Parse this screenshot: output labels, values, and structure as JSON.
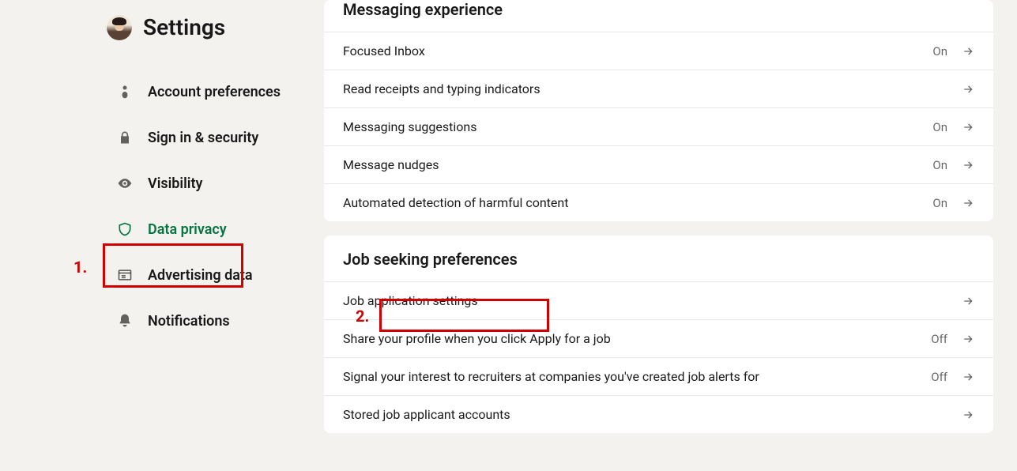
{
  "annotations": {
    "one": "1.",
    "two": "2."
  },
  "sidebar": {
    "title": "Settings",
    "items": [
      {
        "label": "Account preferences"
      },
      {
        "label": "Sign in & security"
      },
      {
        "label": "Visibility"
      },
      {
        "label": "Data privacy"
      },
      {
        "label": "Advertising data"
      },
      {
        "label": "Notifications"
      }
    ]
  },
  "main": {
    "sections": [
      {
        "title": "Messaging experience",
        "rows": [
          {
            "label": "Focused Inbox",
            "status": "On"
          },
          {
            "label": "Read receipts and typing indicators",
            "status": ""
          },
          {
            "label": "Messaging suggestions",
            "status": "On"
          },
          {
            "label": "Message nudges",
            "status": "On"
          },
          {
            "label": "Automated detection of harmful content",
            "status": "On"
          }
        ]
      },
      {
        "title": "Job seeking preferences",
        "rows": [
          {
            "label": "Job application settings",
            "status": ""
          },
          {
            "label": "Share your profile when you click Apply for a job",
            "status": "Off"
          },
          {
            "label": "Signal your interest to recruiters at companies you've created job alerts for",
            "status": "Off"
          },
          {
            "label": "Stored job applicant accounts",
            "status": ""
          }
        ]
      }
    ]
  }
}
